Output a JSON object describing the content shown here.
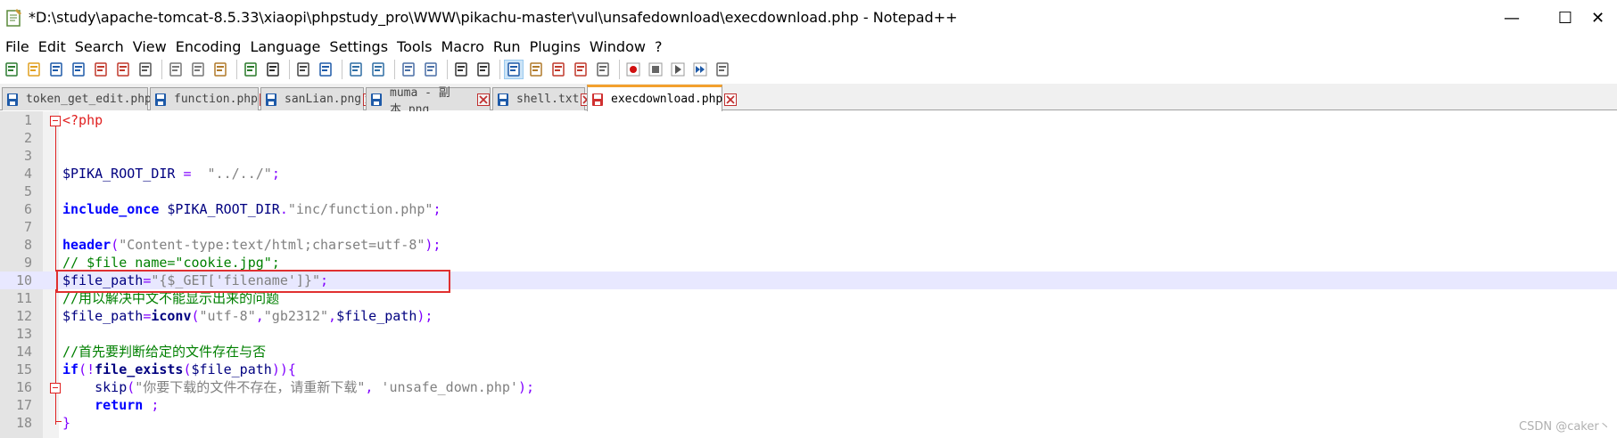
{
  "window": {
    "title": "*D:\\study\\apache-tomcat-8.5.33\\xiaopi\\phpstudy_pro\\WWW\\pikachu-master\\vul\\unsafedownload\\execdownload.php - Notepad++",
    "minimize_glyph": "—",
    "maximize_glyph": "☐",
    "close_glyph": "✕"
  },
  "menu": [
    "File",
    "Edit",
    "Search",
    "View",
    "Encoding",
    "Language",
    "Settings",
    "Tools",
    "Macro",
    "Run",
    "Plugins",
    "Window",
    "?"
  ],
  "toolbar_icons": [
    "new-file-icon",
    "open-file-icon",
    "save-icon",
    "save-all-icon",
    "close-icon",
    "close-all-icon",
    "print-icon",
    "cut-icon",
    "copy-icon",
    "paste-icon",
    "undo-icon",
    "redo-icon",
    "find-icon",
    "replace-icon",
    "zoom-in-icon",
    "zoom-out-icon",
    "sync-vertical-icon",
    "sync-horizontal-icon",
    "word-wrap-icon",
    "show-all-chars-icon",
    "indent-guide-icon",
    "doc-map-icon",
    "function-list-icon",
    "folder-workspace-icon",
    "monitoring-icon",
    "record-macro-icon",
    "stop-record-icon",
    "play-macro-icon",
    "run-macro-multiple-icon",
    "save-macro-icon"
  ],
  "tabs": [
    {
      "label": "token_get_edit.php",
      "active": false
    },
    {
      "label": "function.php",
      "active": false
    },
    {
      "label": "sanLian.png",
      "active": false
    },
    {
      "label": "muma - 副本.png",
      "active": false
    },
    {
      "label": "shell.txt",
      "active": false
    },
    {
      "label": "execdownload.php",
      "active": true
    }
  ],
  "lines": [
    {
      "n": "1",
      "parts": [
        {
          "t": "<?php",
          "c": "php"
        }
      ]
    },
    {
      "n": "2",
      "parts": []
    },
    {
      "n": "3",
      "parts": []
    },
    {
      "n": "4",
      "parts": [
        {
          "t": "$PIKA_ROOT_DIR",
          "c": "var"
        },
        {
          "t": " = ",
          "c": "op"
        },
        {
          "t": " \"../../\"",
          "c": "str"
        },
        {
          "t": ";",
          "c": "op"
        }
      ]
    },
    {
      "n": "5",
      "parts": []
    },
    {
      "n": "6",
      "parts": [
        {
          "t": "include_once",
          "c": "kw"
        },
        {
          "t": " $PIKA_ROOT_DIR",
          "c": "var"
        },
        {
          "t": ".",
          "c": "op"
        },
        {
          "t": "\"inc/function.php\"",
          "c": "str"
        },
        {
          "t": ";",
          "c": "op"
        }
      ]
    },
    {
      "n": "7",
      "parts": []
    },
    {
      "n": "8",
      "parts": [
        {
          "t": "header",
          "c": "kw"
        },
        {
          "t": "(",
          "c": "op"
        },
        {
          "t": "\"Content-type:text/html;charset=utf-8\"",
          "c": "str"
        },
        {
          "t": ");",
          "c": "op"
        }
      ]
    },
    {
      "n": "9",
      "parts": [
        {
          "t": "// $file_name=\"cookie.jpg\";",
          "c": "cmt"
        }
      ]
    },
    {
      "n": "10",
      "parts": [
        {
          "t": "$file_path",
          "c": "var"
        },
        {
          "t": "=",
          "c": "op"
        },
        {
          "t": "\"{$_GET['filename']}\"",
          "c": "str"
        },
        {
          "t": ";",
          "c": "op"
        }
      ]
    },
    {
      "n": "11",
      "parts": [
        {
          "t": "//用以解决中文不能显示出来的问题",
          "c": "cmt"
        }
      ]
    },
    {
      "n": "12",
      "parts": [
        {
          "t": "$file_path",
          "c": "var"
        },
        {
          "t": "=",
          "c": "op"
        },
        {
          "t": "iconv",
          "c": "fn"
        },
        {
          "t": "(",
          "c": "op"
        },
        {
          "t": "\"utf-8\"",
          "c": "str"
        },
        {
          "t": ",",
          "c": "op"
        },
        {
          "t": "\"gb2312\"",
          "c": "str"
        },
        {
          "t": ",",
          "c": "op"
        },
        {
          "t": "$file_path",
          "c": "var"
        },
        {
          "t": ");",
          "c": "op"
        }
      ]
    },
    {
      "n": "13",
      "parts": []
    },
    {
      "n": "14",
      "parts": [
        {
          "t": "//首先要判断给定的文件存在与否",
          "c": "cmt"
        }
      ]
    },
    {
      "n": "15",
      "parts": [
        {
          "t": "if",
          "c": "kw"
        },
        {
          "t": "(!",
          "c": "op"
        },
        {
          "t": "file_exists",
          "c": "fn"
        },
        {
          "t": "(",
          "c": "op"
        },
        {
          "t": "$file_path",
          "c": "var"
        },
        {
          "t": ")){",
          "c": "op"
        }
      ]
    },
    {
      "n": "16",
      "parts": [
        {
          "t": "    skip",
          "c": "plain"
        },
        {
          "t": "(",
          "c": "op"
        },
        {
          "t": "\"你要下载的文件不存在，请重新下载\"",
          "c": "str"
        },
        {
          "t": ", ",
          "c": "op"
        },
        {
          "t": "'unsafe_down.php'",
          "c": "str"
        },
        {
          "t": ");",
          "c": "op"
        }
      ]
    },
    {
      "n": "17",
      "parts": [
        {
          "t": "    return",
          "c": "kw"
        },
        {
          "t": " ;",
          "c": "op"
        }
      ]
    },
    {
      "n": "18",
      "parts": [
        {
          "t": "}",
          "c": "op"
        }
      ]
    }
  ],
  "watermark": "CSDN @caker丶",
  "colors": {
    "accent": "#f3a02e",
    "highlight_box": "#e03030",
    "current_line": "#e8e8ff"
  }
}
